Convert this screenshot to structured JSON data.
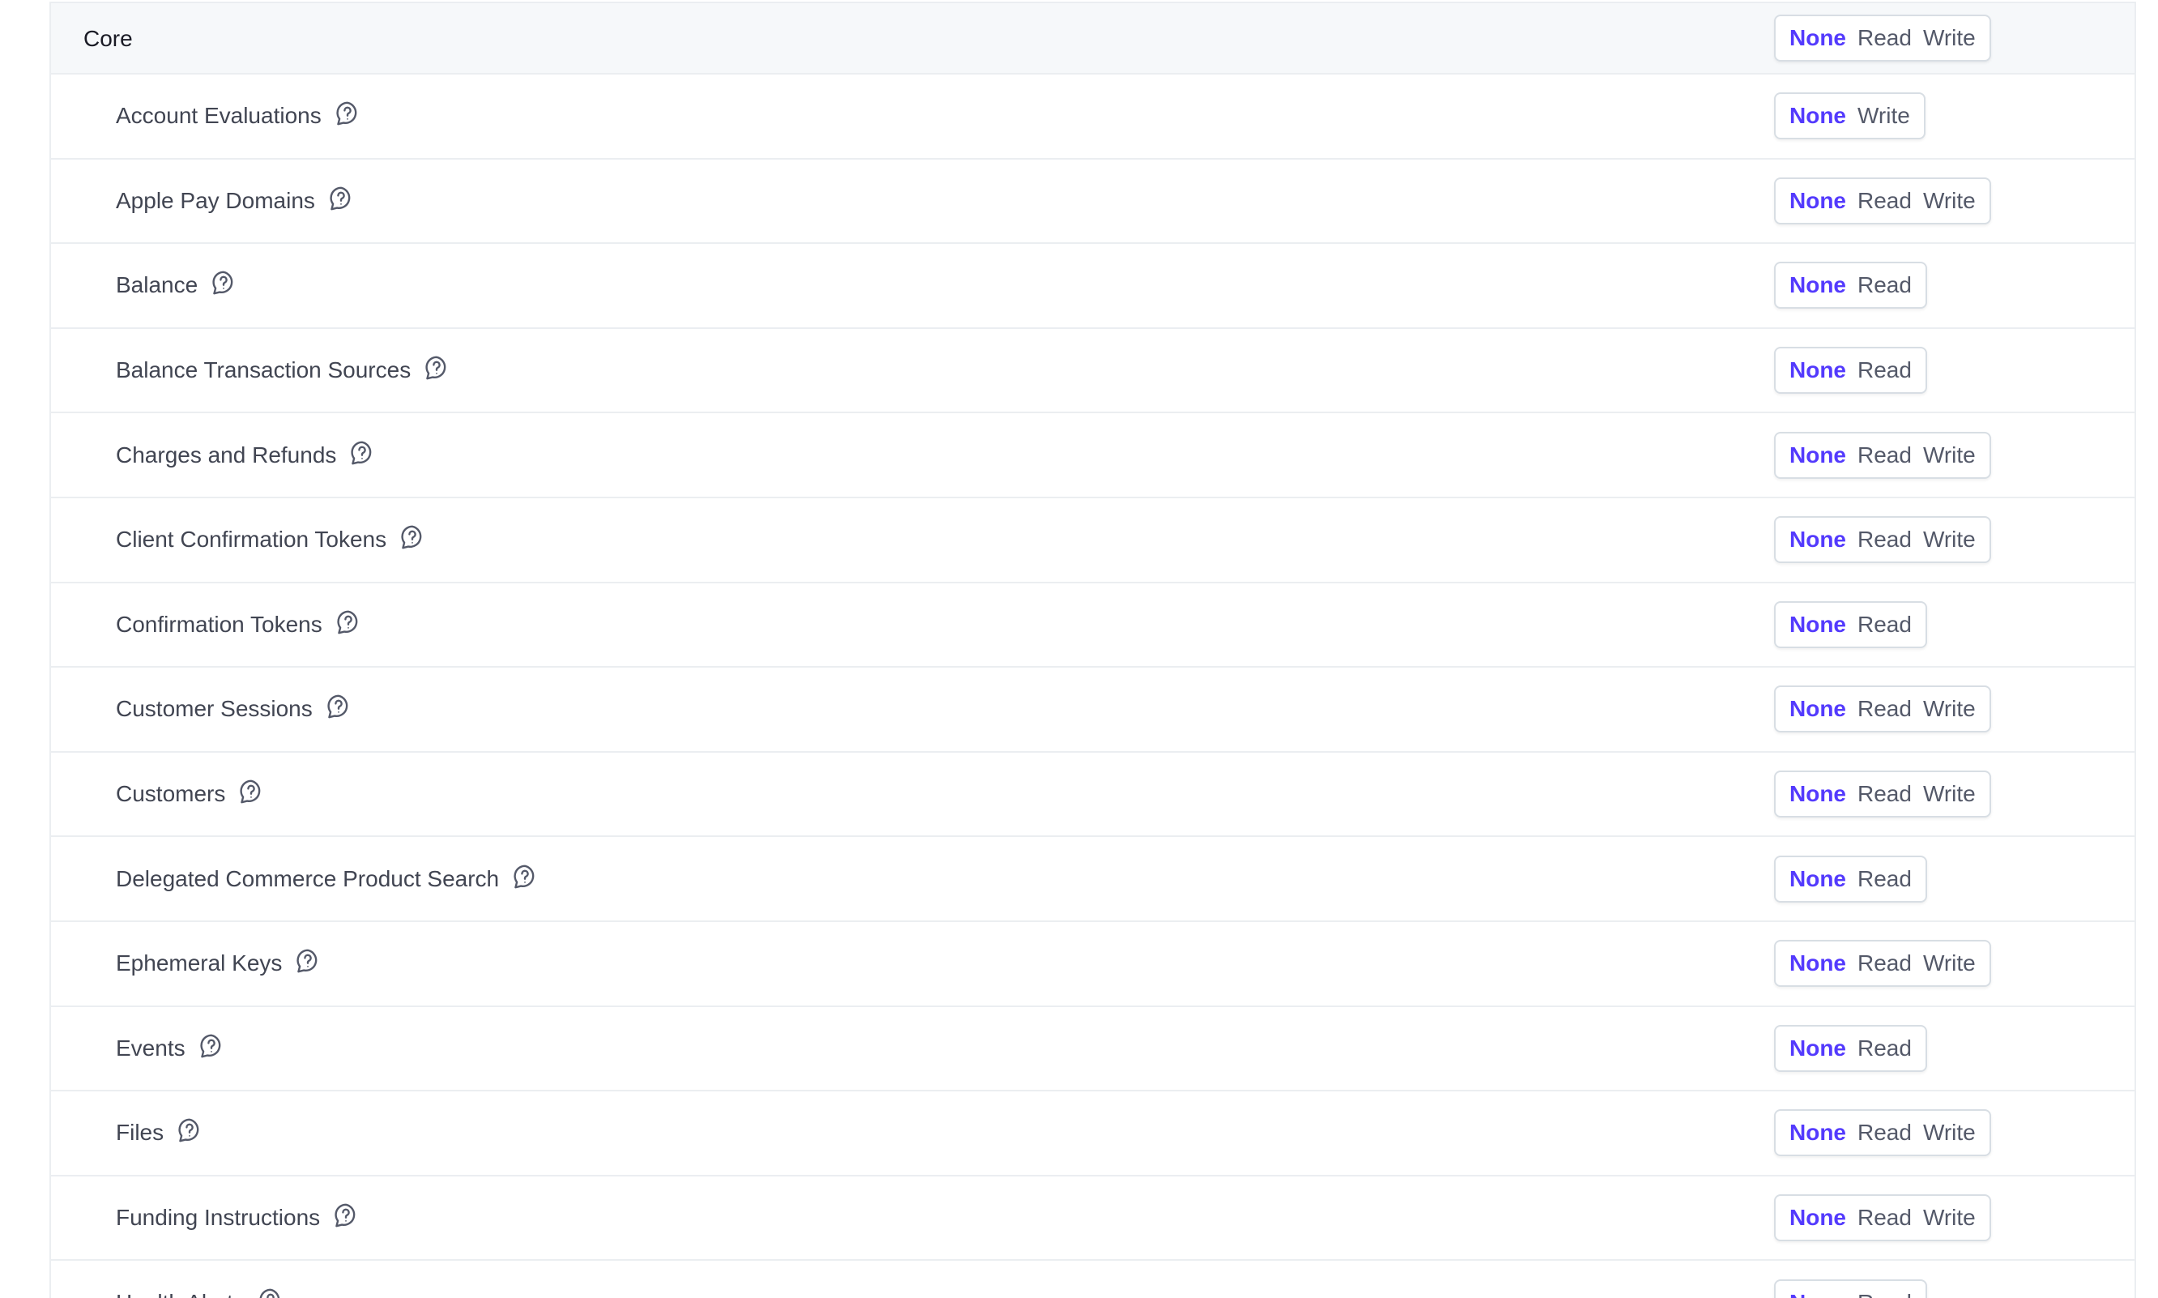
{
  "group": {
    "title": "Core",
    "options": [
      "None",
      "Read",
      "Write"
    ],
    "selected": "None"
  },
  "rows": [
    {
      "label": "Account Evaluations",
      "options": [
        "None",
        "Write"
      ],
      "selected": "None"
    },
    {
      "label": "Apple Pay Domains",
      "options": [
        "None",
        "Read",
        "Write"
      ],
      "selected": "None"
    },
    {
      "label": "Balance",
      "options": [
        "None",
        "Read"
      ],
      "selected": "None"
    },
    {
      "label": "Balance Transaction Sources",
      "options": [
        "None",
        "Read"
      ],
      "selected": "None"
    },
    {
      "label": "Charges and Refunds",
      "options": [
        "None",
        "Read",
        "Write"
      ],
      "selected": "None"
    },
    {
      "label": "Client Confirmation Tokens",
      "options": [
        "None",
        "Read",
        "Write"
      ],
      "selected": "None"
    },
    {
      "label": "Confirmation Tokens",
      "options": [
        "None",
        "Read"
      ],
      "selected": "None"
    },
    {
      "label": "Customer Sessions",
      "options": [
        "None",
        "Read",
        "Write"
      ],
      "selected": "None"
    },
    {
      "label": "Customers",
      "options": [
        "None",
        "Read",
        "Write"
      ],
      "selected": "None"
    },
    {
      "label": "Delegated Commerce Product Search",
      "options": [
        "None",
        "Read"
      ],
      "selected": "None"
    },
    {
      "label": "Ephemeral Keys",
      "options": [
        "None",
        "Read",
        "Write"
      ],
      "selected": "None"
    },
    {
      "label": "Events",
      "options": [
        "None",
        "Read"
      ],
      "selected": "None"
    },
    {
      "label": "Files",
      "options": [
        "None",
        "Read",
        "Write"
      ],
      "selected": "None"
    },
    {
      "label": "Funding Instructions",
      "options": [
        "None",
        "Read",
        "Write"
      ],
      "selected": "None"
    },
    {
      "label": "Health Alerts",
      "options": [
        "None",
        "Read"
      ],
      "selected": "None"
    }
  ],
  "icons": {
    "help": "question-bubble-icon"
  },
  "colors": {
    "accent": "#533afd",
    "text": "#414552",
    "muted": "#545969",
    "border": "#ebeef1",
    "header_bg": "#f6f8fa"
  }
}
